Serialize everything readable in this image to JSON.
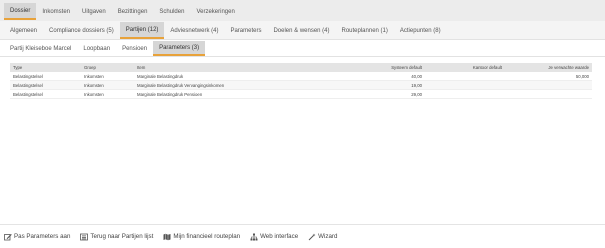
{
  "main_tabs": [
    {
      "label": "Dossier",
      "active": true
    },
    {
      "label": "Inkomsten",
      "active": false
    },
    {
      "label": "Uitgaven",
      "active": false
    },
    {
      "label": "Bezittingen",
      "active": false
    },
    {
      "label": "Schulden",
      "active": false
    },
    {
      "label": "Verzekeringen",
      "active": false
    }
  ],
  "sub_tabs": [
    {
      "label": "Algemeen",
      "active": false
    },
    {
      "label": "Compliance dossiers (5)",
      "active": false
    },
    {
      "label": "Partijen (12)",
      "active": true
    },
    {
      "label": "Adviesnetwerk (4)",
      "active": false
    },
    {
      "label": "Parameters",
      "active": false
    },
    {
      "label": "Doelen & wensen (4)",
      "active": false
    },
    {
      "label": "Routeplannen (1)",
      "active": false
    },
    {
      "label": "Actiepunten (8)",
      "active": false
    }
  ],
  "third_tabs": [
    {
      "label": "Partij Kleiseboe Marcel",
      "active": false
    },
    {
      "label": "Loopbaan",
      "active": false
    },
    {
      "label": "Pensioen",
      "active": false
    },
    {
      "label": "Parameters (3)",
      "active": true
    }
  ],
  "table": {
    "headers": {
      "type": "Type",
      "group": "Groep",
      "item": "Item",
      "sysdef": "Systeem default",
      "klant": "Kantoor default",
      "afw": "Je verwachte waarde"
    },
    "rows": [
      {
        "type": "Belastingstelsel",
        "group": "Inkomsten",
        "item": "Marginale Belastingdruk",
        "sysdef": "40,00",
        "klant": "",
        "afw": "50,000"
      },
      {
        "type": "Belastingstelsel",
        "group": "Inkomsten",
        "item": "Marginale Belastingdruk Vervangingsinkomen",
        "sysdef": "19,00",
        "klant": "",
        "afw": ""
      },
      {
        "type": "Belastingstelsel",
        "group": "Inkomsten",
        "item": "Marginale Belastingdruk Pensioen",
        "sysdef": "29,00",
        "klant": "",
        "afw": ""
      }
    ]
  },
  "footer": {
    "actions": [
      {
        "label": "Pas Parameters aan",
        "icon": "edit-icon"
      },
      {
        "label": "Terug naar Partijen lijst",
        "icon": "list-icon"
      },
      {
        "label": "Mijn financieel routeplan",
        "icon": "map-icon"
      },
      {
        "label": "Web interface",
        "icon": "sitemap-icon"
      },
      {
        "label": "Wizard",
        "icon": "magic-wand-icon"
      }
    ]
  },
  "colors": {
    "accent": "#e8a23a",
    "active_tab_bg": "#d6d6d6"
  }
}
